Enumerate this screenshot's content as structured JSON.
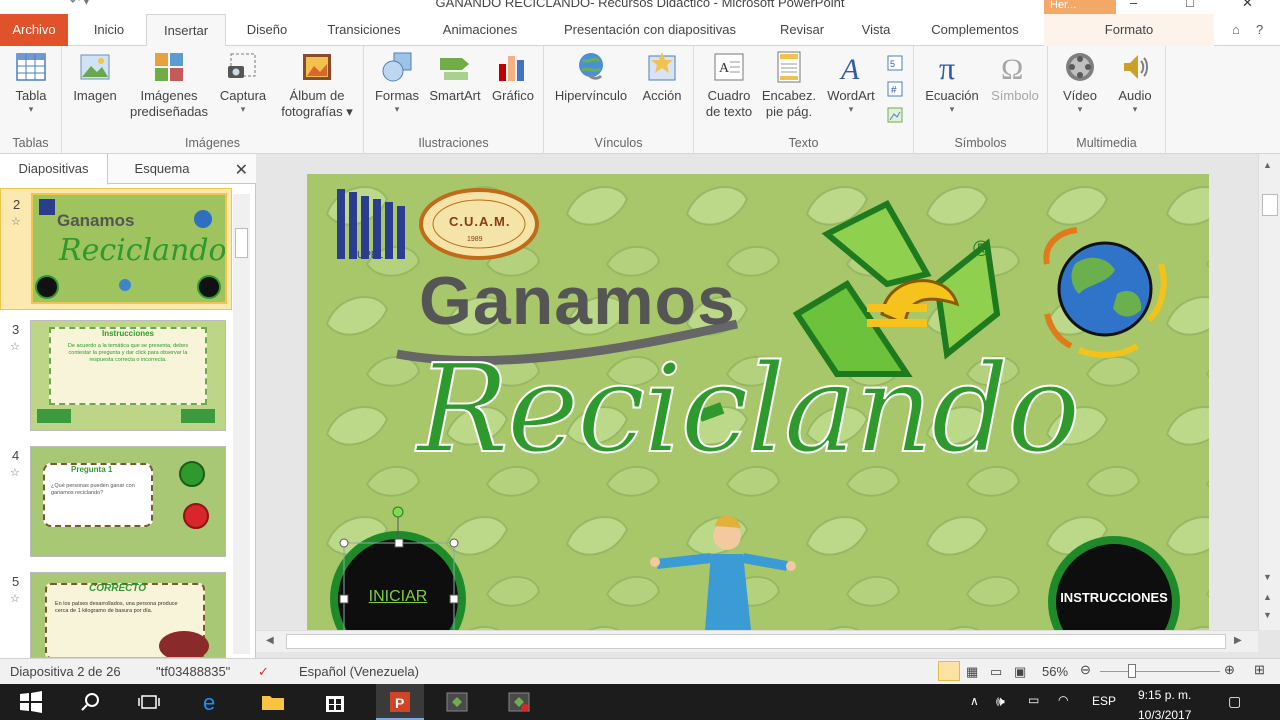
{
  "window": {
    "title": "GANANDO RECICLANDO- Recursos Didactico - Microsoft PowerPoint",
    "context_tab": "Her...",
    "win_controls": [
      "–",
      "□",
      "✕"
    ]
  },
  "tabs": [
    "Archivo",
    "Inicio",
    "Insertar",
    "Diseño",
    "Transiciones",
    "Animaciones",
    "Presentación con diapositivas",
    "Revisar",
    "Vista",
    "Complementos",
    "Formato"
  ],
  "active_tab": "Insertar",
  "ribbon": {
    "groups": [
      {
        "label": "Tablas",
        "buttons": [
          {
            "label1": "Tabla",
            "label2": "",
            "icon": "table-icon"
          }
        ]
      },
      {
        "label": "Imágenes",
        "buttons": [
          {
            "label1": "Imagen",
            "label2": "",
            "icon": "picture-icon"
          },
          {
            "label1": "Imágenes",
            "label2": "prediseñadas",
            "icon": "clipart-icon"
          },
          {
            "label1": "Captura",
            "label2": "",
            "icon": "screenshot-icon"
          },
          {
            "label1": "Álbum de",
            "label2": "fotografías",
            "icon": "photo-album-icon"
          }
        ]
      },
      {
        "label": "Ilustraciones",
        "buttons": [
          {
            "label1": "Formas",
            "label2": "",
            "icon": "shapes-icon"
          },
          {
            "label1": "SmartArt",
            "label2": "",
            "icon": "smartart-icon"
          },
          {
            "label1": "Gráfico",
            "label2": "",
            "icon": "chart-icon"
          }
        ]
      },
      {
        "label": "Vínculos",
        "buttons": [
          {
            "label1": "Hipervínculo",
            "label2": "",
            "icon": "hyperlink-icon"
          },
          {
            "label1": "Acción",
            "label2": "",
            "icon": "action-icon"
          }
        ]
      },
      {
        "label": "Texto",
        "buttons": [
          {
            "label1": "Cuadro",
            "label2": "de texto",
            "icon": "textbox-icon"
          },
          {
            "label1": "Encabez.",
            "label2": "pie pág.",
            "icon": "header-footer-icon"
          },
          {
            "label1": "WordArt",
            "label2": "",
            "icon": "wordart-icon"
          }
        ]
      },
      {
        "label": "Símbolos",
        "buttons": [
          {
            "label1": "Ecuación",
            "label2": "",
            "icon": "equation-icon"
          },
          {
            "label1": "Símbolo",
            "label2": "",
            "icon": "symbol-icon"
          }
        ]
      },
      {
        "label": "Multimedia",
        "buttons": [
          {
            "label1": "Vídeo",
            "label2": "",
            "icon": "video-icon"
          },
          {
            "label1": "Audio",
            "label2": "",
            "icon": "audio-icon"
          }
        ]
      }
    ]
  },
  "left_pane": {
    "tabs": [
      "Diapositivas",
      "Esquema"
    ],
    "close": "✕",
    "thumbs": [
      {
        "num": "2",
        "selected": true,
        "t1": "Ganamos",
        "t2": "Reciclando",
        "note": ""
      },
      {
        "num": "3",
        "selected": false,
        "t1": "Instrucciones",
        "t2": "",
        "note": "De acuerdo a la temática que se presenta, debes contestar la pregunta y dar click para observar la respuesta correcta o incorrecta."
      },
      {
        "num": "4",
        "selected": false,
        "t1": "Pregunta 1",
        "t2": "",
        "note": "¿Qué personas pueden ganar con ganamos reciclando?"
      },
      {
        "num": "5",
        "selected": false,
        "t1": "CORRECTO",
        "t2": "",
        "note": "En los países desarrollados, una persona produce cerca de 1 kilogramo de basura por día."
      }
    ]
  },
  "slide": {
    "logo_text": "UPEL",
    "seal_text": "C.U.A.M.",
    "seal_year": "1989",
    "title_top": "Ganamos",
    "title_bottom": "Reciclando",
    "registered": "®",
    "btn_start": "INICIAR",
    "btn_instr": "INSTRUCCIONES"
  },
  "status": {
    "slide_info": "Diapositiva 2 de 26",
    "theme": "\"tf03488835\"",
    "language": "Español (Venezuela)",
    "zoom": "56%"
  },
  "taskbar": {
    "lang": "ESP",
    "time": "9:15 p. m.",
    "date": "10/3/2017"
  },
  "colors": {
    "file_tab": "#e0522a",
    "slide_bg": "#a8c76a",
    "title_green": "#2e9a2e",
    "title_gray": "#555555",
    "selected_thumb": "#f0c64c"
  }
}
